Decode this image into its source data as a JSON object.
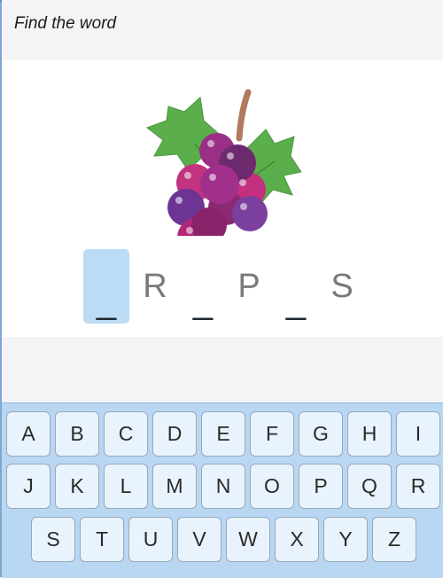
{
  "header": {
    "instruction": "Find the word"
  },
  "picture": {
    "icon": "grapes-icon"
  },
  "word": {
    "slots": [
      "_",
      "R",
      "_",
      "P",
      "_",
      "S"
    ],
    "active_index": 0
  },
  "keyboard": {
    "row1": [
      "A",
      "B",
      "C",
      "D",
      "E",
      "F",
      "G",
      "H",
      "I"
    ],
    "row2": [
      "J",
      "K",
      "L",
      "M",
      "N",
      "O",
      "P",
      "Q",
      "R"
    ],
    "row3": [
      "S",
      "T",
      "U",
      "V",
      "W",
      "X",
      "Y",
      "Z"
    ]
  },
  "colors": {
    "active_slot": "#bcdcf6",
    "keyboard_bg": "#b9d7f2",
    "key_bg": "#e9f3fd"
  }
}
